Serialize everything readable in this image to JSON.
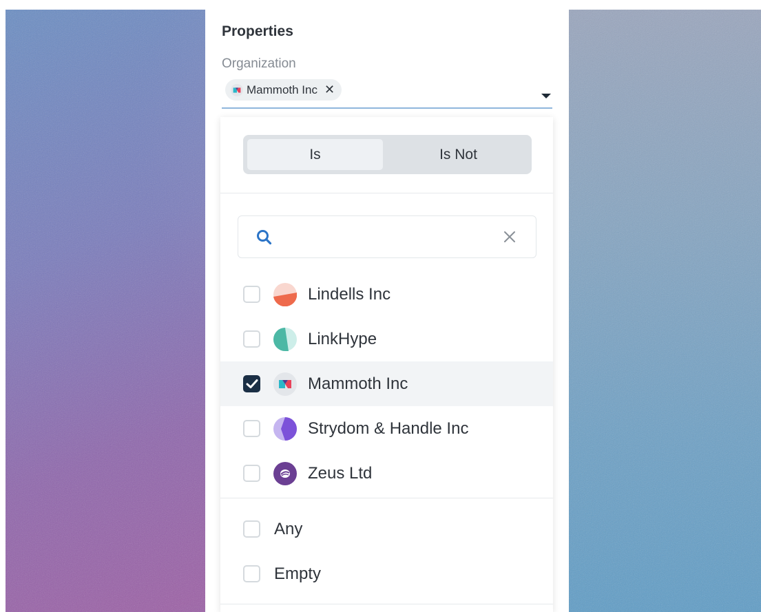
{
  "panel": {
    "title": "Properties",
    "organization_label": "Organization",
    "selected_chip": {
      "label": "Mammoth Inc",
      "remove_symbol": "✕"
    }
  },
  "dropdown": {
    "segments": [
      {
        "label": "Is",
        "active": true
      },
      {
        "label": "Is Not",
        "active": false
      }
    ],
    "search": {
      "value": "",
      "placeholder": "",
      "clear_symbol": "✕"
    },
    "organizations": [
      {
        "label": "Lindells Inc",
        "checked": false,
        "icon": "lindells-logo-icon"
      },
      {
        "label": "LinkHype",
        "checked": false,
        "icon": "linkhype-logo-icon"
      },
      {
        "label": "Mammoth Inc",
        "checked": true,
        "icon": "mammoth-logo-icon"
      },
      {
        "label": "Strydom & Handle Inc",
        "checked": false,
        "icon": "strydom-logo-icon"
      },
      {
        "label": "Zeus Ltd",
        "checked": false,
        "icon": "zeus-logo-icon"
      }
    ],
    "special_options": [
      {
        "label": "Any",
        "checked": false
      },
      {
        "label": "Empty",
        "checked": false
      }
    ]
  },
  "colors": {
    "accent_underline": "#8fb6dc",
    "checkbox_checked": "#1b2f45",
    "search_icon": "#2b74c7"
  }
}
